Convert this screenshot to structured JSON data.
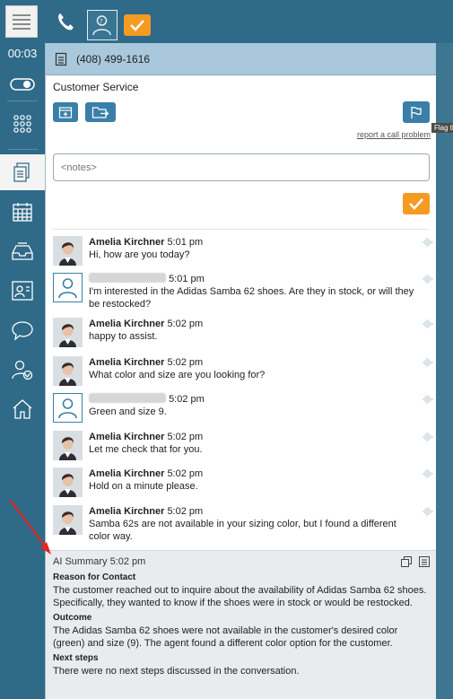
{
  "timer": "00:03",
  "call": {
    "phone_number": "(408) 499-1616",
    "queue": "Customer Service",
    "report_link": "report a call problem",
    "tooltip": "Flag the call"
  },
  "notes": {
    "placeholder": "<notes>"
  },
  "messages": [
    {
      "sender": "Amelia Kirchner",
      "role": "agent",
      "time": "5:01 pm",
      "text": "Hi, how are you today?"
    },
    {
      "sender": "",
      "role": "customer",
      "time": "5:01 pm",
      "text": "I'm interested in the Adidas Samba 62 shoes. Are they in stock, or will they be restocked?"
    },
    {
      "sender": "Amelia Kirchner",
      "role": "agent",
      "time": "5:02 pm",
      "text": "happy to assist."
    },
    {
      "sender": "Amelia Kirchner",
      "role": "agent",
      "time": "5:02 pm",
      "text": "What color and size are you looking for?"
    },
    {
      "sender": "",
      "role": "customer",
      "time": "5:02 pm",
      "text": "Green and size 9."
    },
    {
      "sender": "Amelia Kirchner",
      "role": "agent",
      "time": "5:02 pm",
      "text": "Let me check that for you."
    },
    {
      "sender": "Amelia Kirchner",
      "role": "agent",
      "time": "5:02 pm",
      "text": "Hold on a minute please."
    },
    {
      "sender": "Amelia Kirchner",
      "role": "agent",
      "time": "5:02 pm",
      "text": "Samba 62s are not available in your sizing color, but I found a different color way."
    }
  ],
  "summary": {
    "title": "AI Summary 5:02 pm",
    "reason_heading": "Reason for Contact",
    "reason_text": "The customer reached out to inquire about the availability of Adidas Samba 62 shoes. Specifically, they wanted to know if the shoes were in stock or would be restocked.",
    "outcome_heading": "Outcome",
    "outcome_text": "The Adidas Samba 62 shoes were not available in the customer's desired color (green) and size (9). The agent found a different color option for the customer.",
    "next_heading": "Next steps",
    "next_text": "There were no next steps discussed in the conversation."
  },
  "colors": {
    "accent": "#f59a23",
    "sidebar": "#2f6a88",
    "header": "#a9c8db",
    "annotation_arrow": "#e8251f"
  }
}
